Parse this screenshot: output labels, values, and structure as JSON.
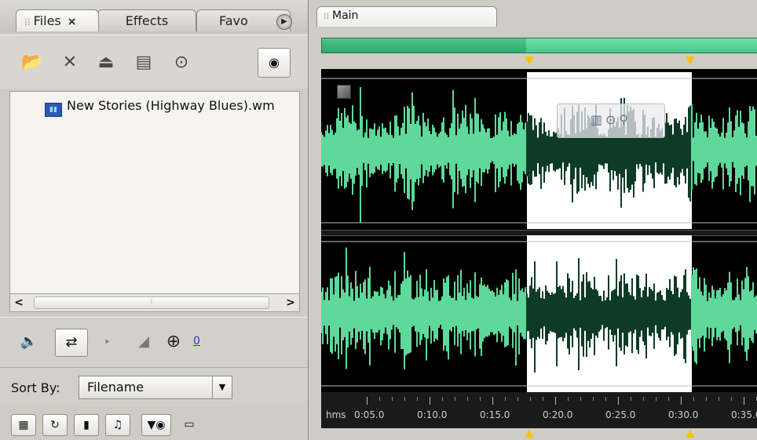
{
  "left_panel": {
    "tabs": [
      {
        "label": "Files",
        "close": "×"
      },
      {
        "label": "Effects"
      },
      {
        "label": "Favo"
      }
    ],
    "toolbar_icons": [
      "import-icon",
      "close-file-icon",
      "insert-multitrack-icon",
      "insert-cd-icon",
      "autoplay-icon"
    ],
    "file_list": {
      "items": [
        {
          "name": "New Stories (Highway Blues).wm",
          "icon": "wma-file-icon"
        }
      ]
    },
    "transport_icons": [
      "speaker-icon",
      "loop-icon",
      "play-small-icon",
      "volume-ramp-icon",
      "volume-knob-icon"
    ],
    "volume_value": "0",
    "sort": {
      "label": "Sort By:",
      "selected": "Filename"
    },
    "filter_icons": [
      "audio-filter-icon",
      "loop-filter-icon",
      "video-filter-icon",
      "midi-filter-icon",
      "preview-eye-icon",
      "metadata-icon"
    ]
  },
  "main_panel": {
    "tab_label": "Main",
    "ruler": {
      "unit": "hms",
      "ticks": [
        "0:05.0",
        "0:10.0",
        "0:15.0",
        "0:20.0",
        "0:25.0",
        "0:30.0",
        "0:35.0"
      ]
    },
    "selection": {
      "start_time": "0:16.7",
      "end_time": "0:30.4"
    },
    "colors": {
      "waveform": "#5fd89b",
      "waveform_selected": "#0d3b26",
      "background": "#000000",
      "selection_bg": "#ffffff",
      "marker": "#f2c400"
    }
  }
}
